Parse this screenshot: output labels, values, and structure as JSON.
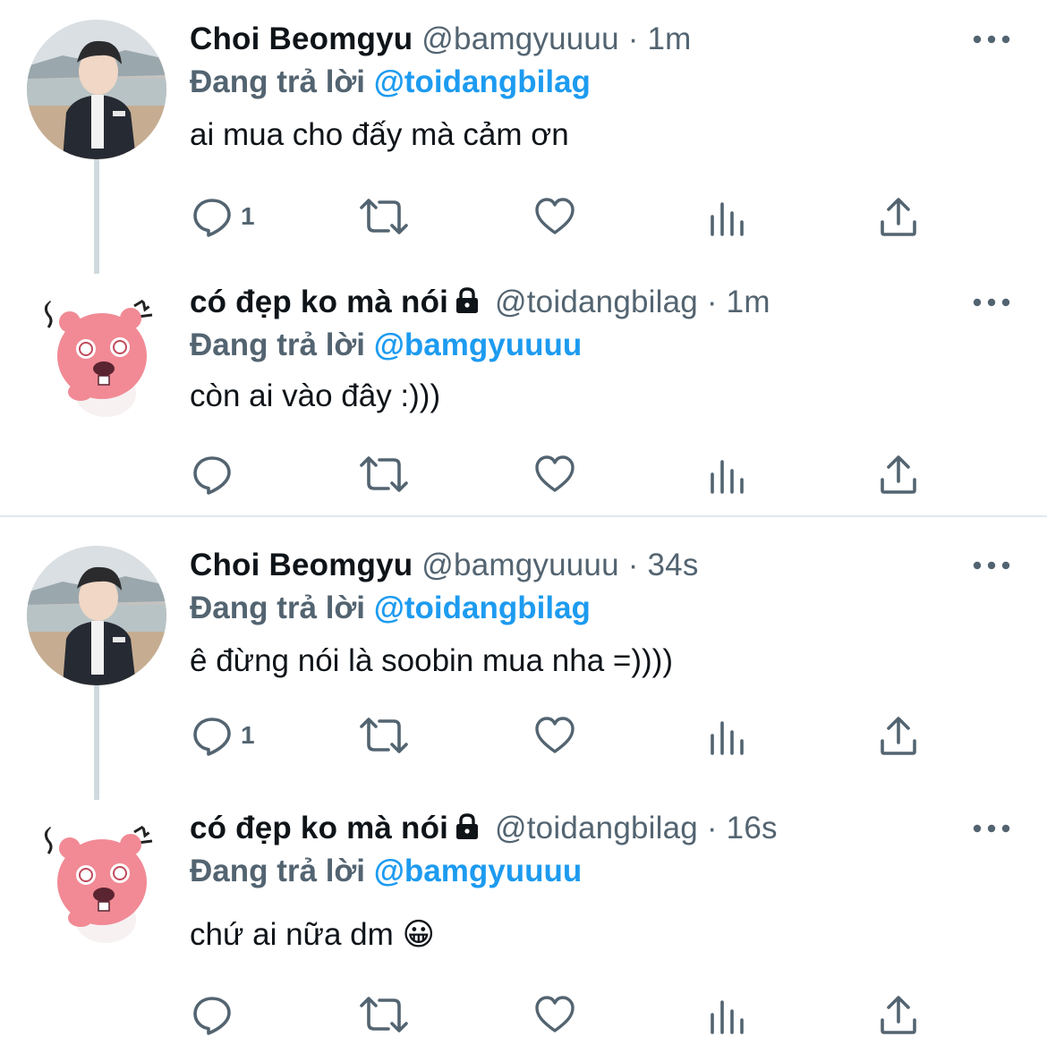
{
  "tweets": [
    {
      "name": "Choi Beomgyu",
      "handle": "@bamgyuuuu",
      "dot": "·",
      "time": "1m",
      "reply_prefix": "Đang trả lời",
      "reply_to": "@toidangbilag",
      "text": "ai mua cho đấy mà cảm ơn",
      "reply_count": "1",
      "avatar": "photo",
      "locked": false
    },
    {
      "name": "có đẹp ko mà nói",
      "handle": "@toidangbilag",
      "dot": "·",
      "time": "1m",
      "reply_prefix": "Đang trả lời",
      "reply_to": "@bamgyuuuu",
      "text": "còn ai vào đây :)))",
      "reply_count": "",
      "avatar": "mascot",
      "locked": true
    },
    {
      "name": "Choi Beomgyu",
      "handle": "@bamgyuuuu",
      "dot": "·",
      "time": "34s",
      "reply_prefix": "Đang trả lời",
      "reply_to": "@toidangbilag",
      "text": "ê đừng nói là soobin mua nha =))))",
      "reply_count": "1",
      "avatar": "photo",
      "locked": false
    },
    {
      "name": "có đẹp ko mà nói",
      "handle": "@toidangbilag",
      "dot": "·",
      "time": "16s",
      "reply_prefix": "Đang trả lời",
      "reply_to": "@bamgyuuuu",
      "text": "chứ ai nữa dm 😀",
      "reply_count": "",
      "avatar": "mascot",
      "locked": true
    }
  ],
  "colors": {
    "mention": "#1d9bf0",
    "secondary_text": "#536471",
    "icon": "#536471",
    "thread_line": "#cfd9de"
  },
  "icons": {
    "lock": "lock-icon",
    "more": "more-icon",
    "reply": "reply-icon",
    "retweet": "retweet-icon",
    "like": "like-icon",
    "views": "views-icon",
    "share": "share-icon"
  }
}
